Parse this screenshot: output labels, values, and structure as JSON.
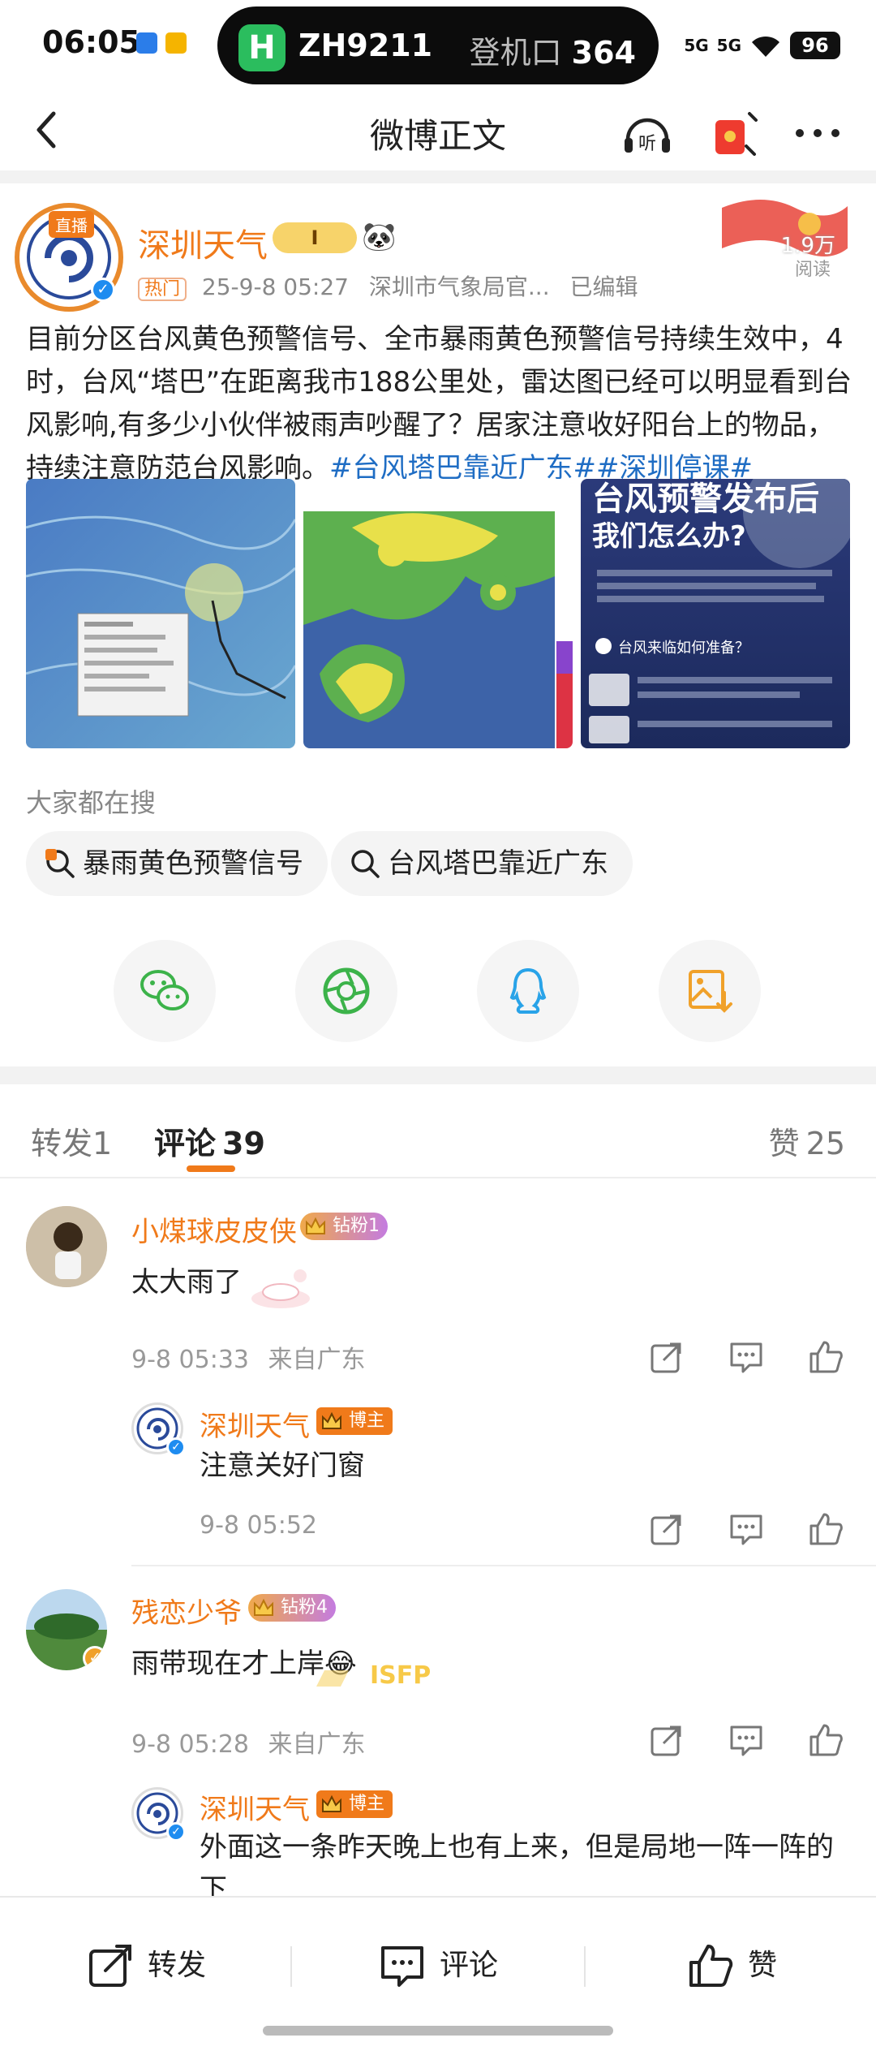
{
  "status_bar": {
    "time": "06:05",
    "flight": "ZH9211",
    "gate_label": "登机口",
    "gate_number": "364",
    "signal_1": "5G",
    "signal_2": "5G",
    "battery": "96"
  },
  "nav": {
    "title": "微博正文",
    "listen_label": "听"
  },
  "post": {
    "live_tag": "直播",
    "author": "深圳天气",
    "vip_level": "I",
    "hot_tag": "热门",
    "time": "25-9-8 05:27",
    "source": "深圳市气象局官...",
    "edited": "已编辑",
    "reads_count": "1.9万",
    "reads_label": "阅读",
    "text": "目前分区台风黄色预警信号、全市暴雨黄色预警信号持续生效中，4时，台风“塔巴”在距离我市188公里处，雷达图已经可以明显看到台风影响,有多少小伙伴被雨声吵醒了？居家注意收好阳台上的物品，持续注意防范台风影响。",
    "hashtags": "#台风塔巴靠近广东##深圳停课#",
    "image3_title": "台风预警发布后 我们怎么办?",
    "image3_subtitle": "台风来临如何准备？"
  },
  "searches": {
    "label": "大家都在搜",
    "items": [
      "暴雨黄色预警信号",
      "台风塔巴靠近广东"
    ]
  },
  "share": {
    "targets": [
      "wechat-icon",
      "moments-icon",
      "qq-icon",
      "save-image-icon"
    ]
  },
  "tabs": {
    "repost": "转发",
    "repost_count": "1",
    "comments": "评论",
    "comments_count": "39",
    "likes": "赞",
    "likes_count": "25"
  },
  "comments": [
    {
      "user": "小煤球皮皮侠",
      "fan_badge": "钻粉1",
      "text": "太大雨了",
      "time": "9-8 05:33",
      "location": "来自广东",
      "reply": {
        "user": "深圳天气",
        "badge": "博主",
        "text": "注意关好门窗",
        "time": "9-8 05:52"
      }
    },
    {
      "user": "残恋少爷",
      "fan_badge": "钻粉4",
      "text": "雨带现在才上岸😂",
      "time": "9-8 05:28",
      "location": "来自广东",
      "reply": {
        "user": "深圳天气",
        "badge": "博主",
        "text": "外面这一条昨天晚上也有上来，但是局地一阵一阵的下"
      }
    }
  ],
  "bottom_bar": {
    "repost": "转发",
    "comment": "评论",
    "like": "赞"
  },
  "colors": {
    "accent": "#f07a1a",
    "hashtag": "#1f6dc4",
    "wechat": "#3cb34a",
    "qq": "#29a3e8"
  }
}
